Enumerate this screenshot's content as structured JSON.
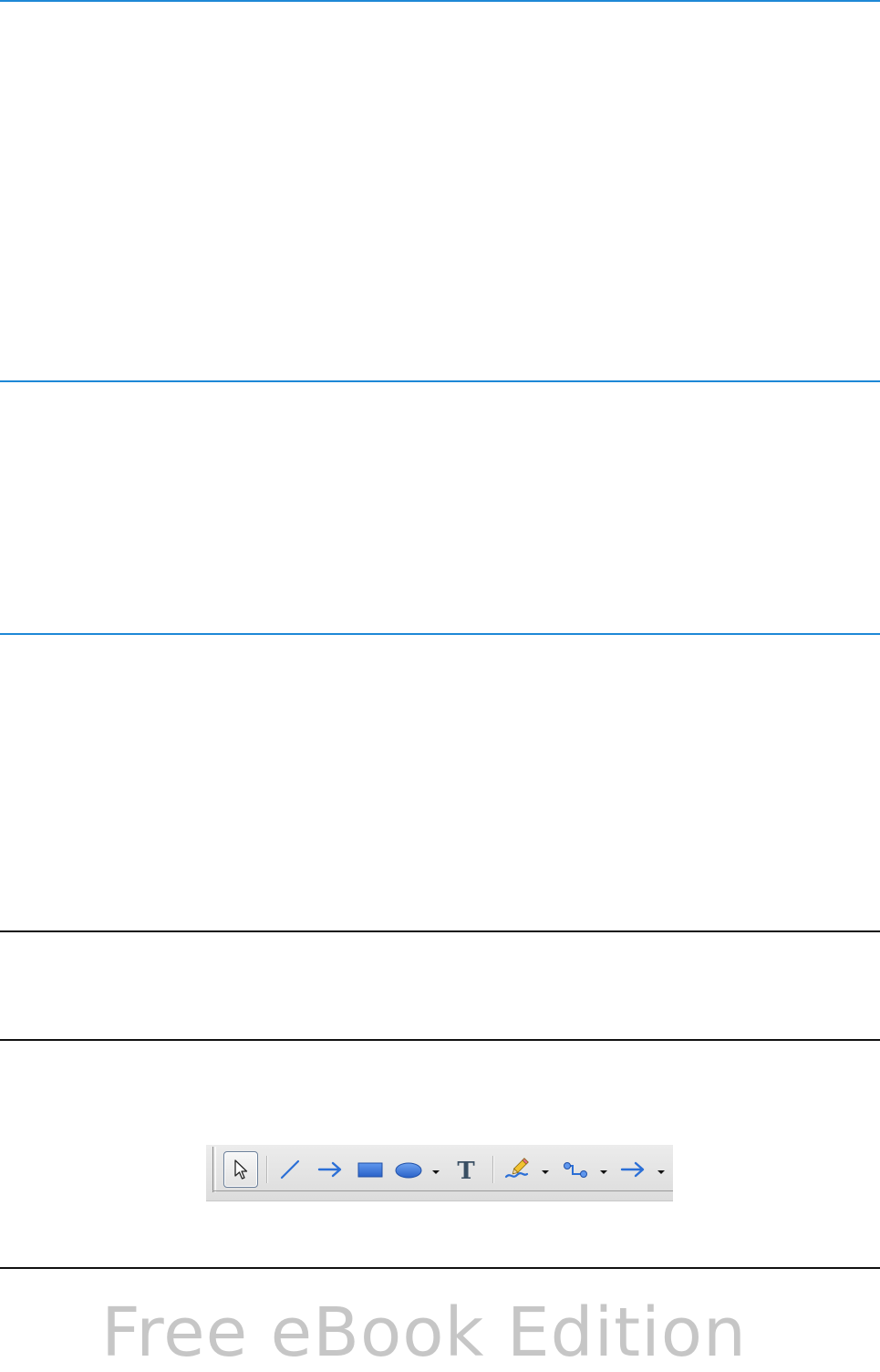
{
  "colors": {
    "rule_blue": "#1e88d6",
    "rule_black": "#111111",
    "icon_blue": "#2b6fd6",
    "watermark_gray": "#c6c6c6"
  },
  "toolbar": {
    "items": [
      {
        "icon": "select-pointer-icon",
        "active": true
      },
      {
        "icon": "line-icon"
      },
      {
        "icon": "line-ends-with-arrow-icon"
      },
      {
        "icon": "rectangle-icon"
      },
      {
        "icon": "ellipse-icon",
        "dropdown": true
      },
      {
        "icon": "text-icon"
      },
      {
        "icon": "freeform-line-icon",
        "dropdown": true
      },
      {
        "icon": "connector-icon",
        "dropdown": true
      },
      {
        "icon": "block-arrows-icon",
        "dropdown": true
      }
    ]
  },
  "watermark": {
    "text": "Free eBook Edition"
  }
}
